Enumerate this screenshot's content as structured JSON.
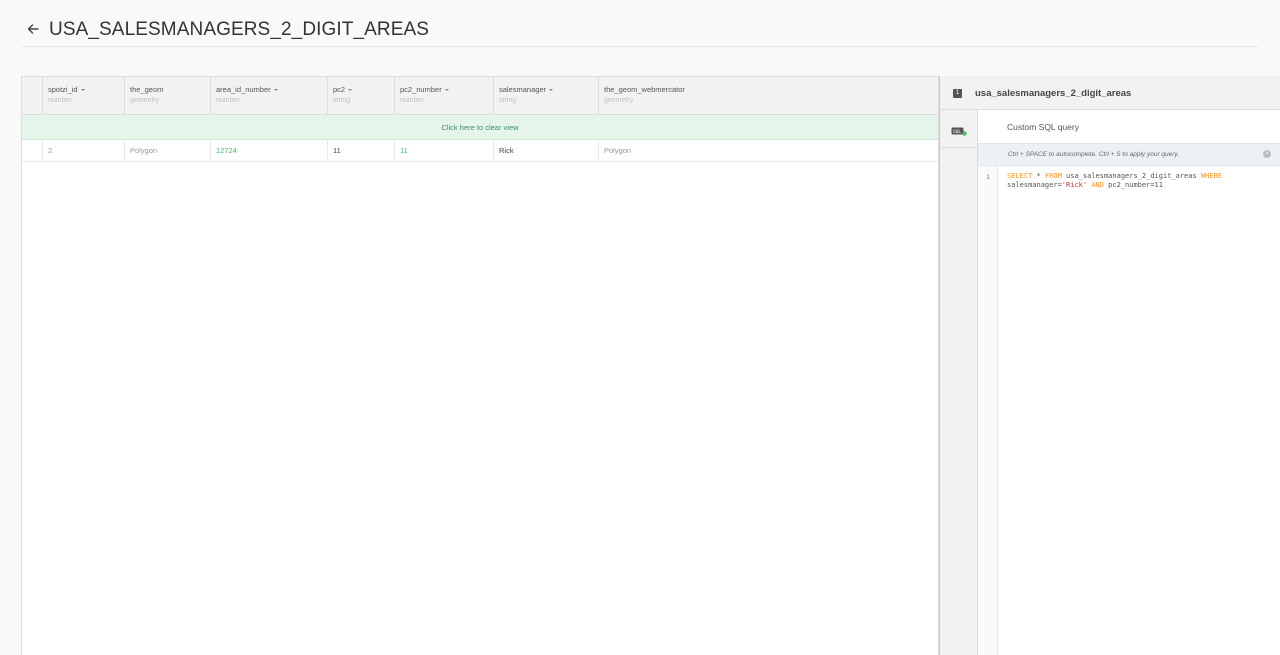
{
  "header": {
    "title": "USA_SALESMANAGERS_2_DIGIT_AREAS"
  },
  "table": {
    "columns": [
      {
        "name": "spotzi_id",
        "type": "number",
        "sortable": true
      },
      {
        "name": "the_geom",
        "type": "geometry",
        "sortable": false
      },
      {
        "name": "area_id_number",
        "type": "number",
        "sortable": true
      },
      {
        "name": "pc2",
        "type": "string",
        "sortable": true
      },
      {
        "name": "pc2_number",
        "type": "number",
        "sortable": true
      },
      {
        "name": "salesmanager",
        "type": "string",
        "sortable": true
      },
      {
        "name": "the_geom_webmercator",
        "type": "geometry",
        "sortable": false
      }
    ],
    "clear_view_label": "Click here to clear view",
    "rows": [
      [
        "2",
        "Polygon",
        "12724",
        "11",
        "11",
        "Rick",
        "Polygon"
      ]
    ]
  },
  "side_panel": {
    "layer_number": "1",
    "layer_name": "usa_salesmanagers_2_digit_areas",
    "editor_title": "Custom SQL query",
    "hint": "Ctrl + SPACE to autocomplete. Ctrl + S to apply your query.",
    "line_number": "1",
    "sql": {
      "kw_select": "SELECT",
      "star": " * ",
      "kw_from": "FROM",
      "table": " usa_salesmanagers_2_digit_areas ",
      "kw_where": "WHERE",
      "field1": "salesmanager=",
      "value1": "'Rick'",
      "kw_and": "AND",
      "field2": " pc2_number=11"
    }
  },
  "colors": {
    "accent_green": "#48b960",
    "clear_bar_bg": "#e6f5e9",
    "sql_keyword": "#f39a2c",
    "sql_string": "#c0392b"
  },
  "icons": [
    "arrow-left-icon",
    "sql-icon",
    "close-icon",
    "caret-down-icon"
  ]
}
